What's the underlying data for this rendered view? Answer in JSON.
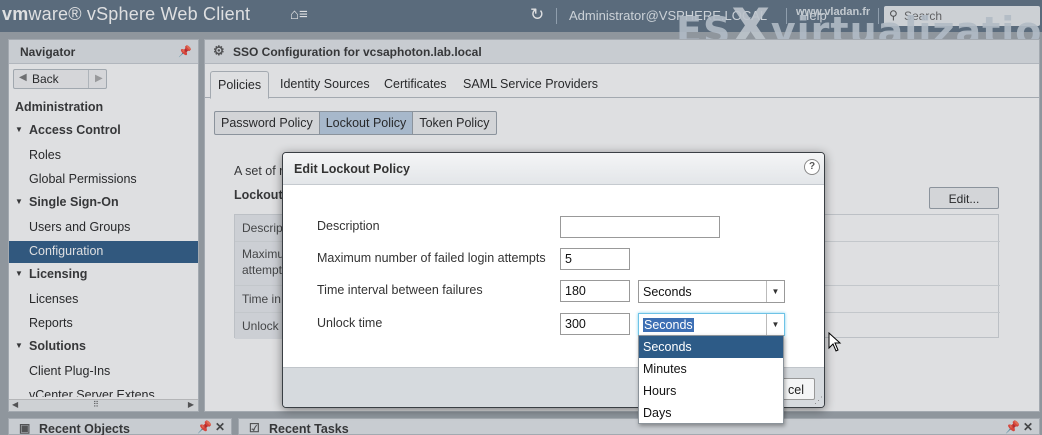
{
  "header": {
    "brand_vm": "vm",
    "brand_rest": "ware® vSphere Web Client",
    "user": "Administrator@VSPHERE.LOCAL",
    "help": "Help",
    "search_placeholder": "Search",
    "watermark_url": "www.vladan.fr",
    "watermark_pre": "ES",
    "watermark_x": "X",
    "watermark_post": "virtualization"
  },
  "navigator": {
    "title": "Navigator",
    "back_label": "Back",
    "items": [
      {
        "label": "Administration",
        "kind": "heading"
      },
      {
        "label": "Access Control",
        "kind": "group"
      },
      {
        "label": "Roles",
        "kind": "item"
      },
      {
        "label": "Global Permissions",
        "kind": "item"
      },
      {
        "label": "Single Sign-On",
        "kind": "group"
      },
      {
        "label": "Users and Groups",
        "kind": "item"
      },
      {
        "label": "Configuration",
        "kind": "item",
        "selected": true
      },
      {
        "label": "Licensing",
        "kind": "group"
      },
      {
        "label": "Licenses",
        "kind": "item"
      },
      {
        "label": "Reports",
        "kind": "item"
      },
      {
        "label": "Solutions",
        "kind": "group"
      },
      {
        "label": "Client Plug-Ins",
        "kind": "item"
      },
      {
        "label": "vCenter Server Extens",
        "kind": "item"
      }
    ]
  },
  "main": {
    "title": "SSO Configuration for vcsaphoton.lab.local",
    "tabs": [
      "Policies",
      "Identity Sources",
      "Certificates",
      "SAML Service Providers"
    ],
    "policy_tabs": [
      "Password Policy",
      "Lockout Policy",
      "Token Policy"
    ],
    "intro_fragment": "A set of r",
    "section_fragment": "Lockout",
    "edit_button": "Edit...",
    "rows": [
      "Descrip",
      "Maximu\nattempt",
      "Time in",
      "Unlock"
    ]
  },
  "bottom_panels": {
    "recent_objects": "Recent Objects",
    "recent_tasks": "Recent Tasks"
  },
  "dialog": {
    "title": "Edit Lockout Policy",
    "fields": {
      "description_label": "Description",
      "description_value": "",
      "max_attempts_label": "Maximum number of failed login attempts",
      "max_attempts_value": "5",
      "interval_label": "Time interval between failures",
      "interval_value": "180",
      "interval_unit": "Seconds",
      "unlock_label": "Unlock time",
      "unlock_value": "300",
      "unlock_unit": "Seconds"
    },
    "cancel_fragment": "cel",
    "dropdown_options": [
      "Seconds",
      "Minutes",
      "Hours",
      "Days"
    ],
    "dropdown_highlighted": "Seconds"
  }
}
